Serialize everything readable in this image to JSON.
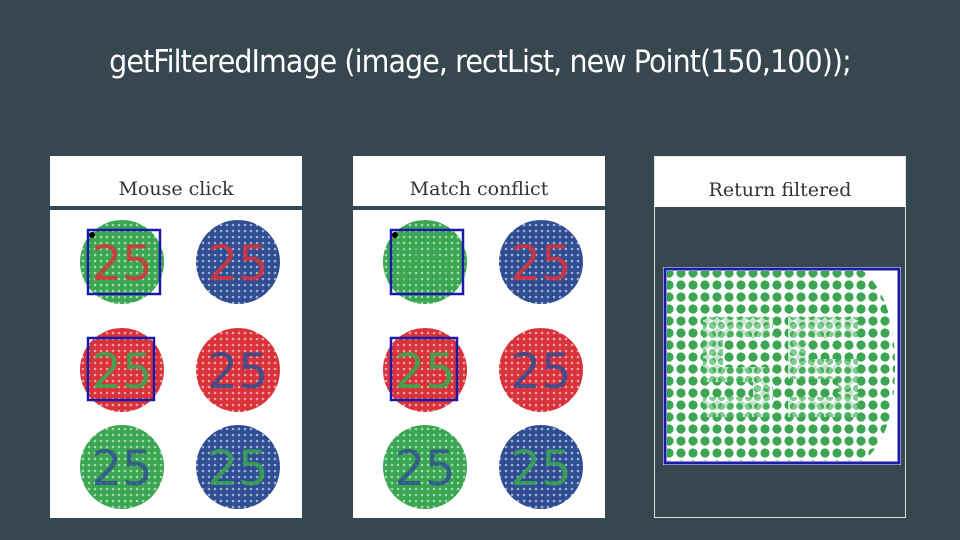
{
  "title": "getFilteredImage (image, rectList, new Point(150,100));",
  "panels": [
    {
      "label": "Mouse click"
    },
    {
      "label": "Match conflict"
    },
    {
      "label": "Return filtered"
    }
  ],
  "plate_number": "25",
  "colors": {
    "background": "#37474f",
    "green": "#3aa651",
    "red": "#d9323b",
    "blue": "#2f4d92",
    "selection": "#1a1aa8"
  }
}
